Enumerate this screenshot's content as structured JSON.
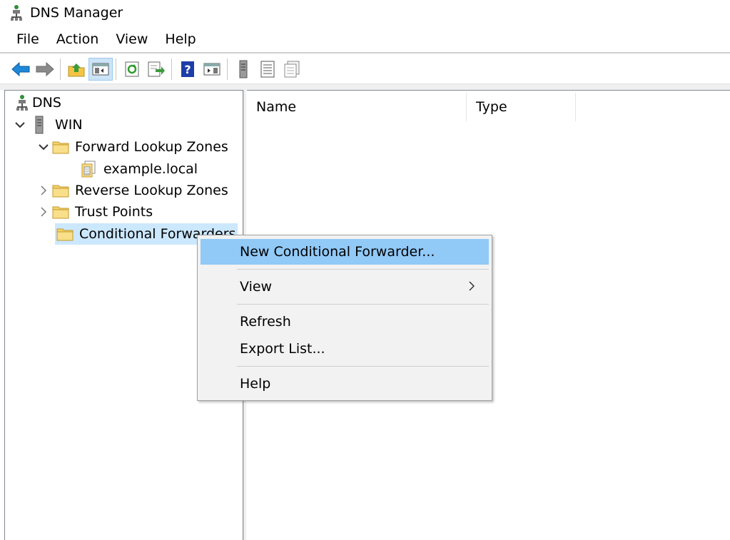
{
  "window": {
    "title": "DNS Manager"
  },
  "menubar": {
    "items": [
      "File",
      "Action",
      "View",
      "Help"
    ]
  },
  "toolbar": {
    "buttons": [
      "back-icon",
      "forward-icon",
      "up-folder-icon",
      "show-hide-console-tree-icon",
      "refresh-icon",
      "export-list-icon",
      "help-icon",
      "show-hide-action-pane-icon",
      "server-icon",
      "list-icon",
      "properties-icon"
    ]
  },
  "tree": {
    "root": "DNS",
    "server": "WIN",
    "forward_zones": "Forward Lookup Zones",
    "zone": "example.local",
    "reverse_zones": "Reverse Lookup Zones",
    "trust_points": "Trust Points",
    "conditional_forwarders": "Conditional Forwarders"
  },
  "list": {
    "columns": [
      "Name",
      "Type"
    ]
  },
  "context_menu": {
    "items": [
      {
        "label": "New Conditional Forwarder...",
        "highlighted": true
      },
      {
        "label": "View",
        "submenu": true
      },
      {
        "label": "Refresh"
      },
      {
        "label": "Export List..."
      },
      {
        "label": "Help"
      }
    ]
  },
  "colors": {
    "selection": "#cce8ff",
    "menu_hover": "#91c9f7",
    "folder": "#f5d26b"
  }
}
